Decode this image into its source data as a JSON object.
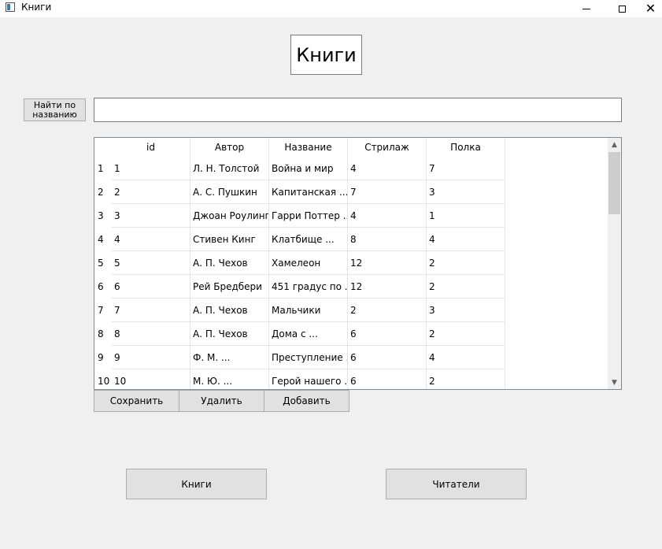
{
  "window": {
    "title": "Книги",
    "close_glyph": "✕"
  },
  "heading": "Книги",
  "search": {
    "button_label_line1": "Найти по",
    "button_label_line2": "названию",
    "value": ""
  },
  "table": {
    "columns": [
      "id",
      "Автор",
      "Название",
      "Стрилаж",
      "Полка"
    ],
    "rows": [
      {
        "num": "1",
        "id": "1",
        "author": "Л. Н. Толстой",
        "title": "Война и мир",
        "rack": "4",
        "shelf": "7"
      },
      {
        "num": "2",
        "id": "2",
        "author": "А. С. Пушкин",
        "title": "Капитанская ...",
        "rack": "7",
        "shelf": "3"
      },
      {
        "num": "3",
        "id": "3",
        "author": "Джоан Роулинг",
        "title": "Гарри Поттер ...",
        "rack": "4",
        "shelf": "1"
      },
      {
        "num": "4",
        "id": "4",
        "author": "Стивен Кинг",
        "title": "Клатбище ...",
        "rack": "8",
        "shelf": "4"
      },
      {
        "num": "5",
        "id": "5",
        "author": "А. П. Чехов",
        "title": "Хамелеон",
        "rack": "12",
        "shelf": "2"
      },
      {
        "num": "6",
        "id": "6",
        "author": "Рей Бредбери",
        "title": "451 градус по ...",
        "rack": "12",
        "shelf": "2"
      },
      {
        "num": "7",
        "id": "7",
        "author": "А. П. Чехов",
        "title": "Мальчики",
        "rack": "2",
        "shelf": "3"
      },
      {
        "num": "8",
        "id": "8",
        "author": "А. П. Чехов",
        "title": "Дома с ...",
        "rack": "6",
        "shelf": "2"
      },
      {
        "num": "9",
        "id": "9",
        "author": "Ф. М. ...",
        "title": "Преступление ...",
        "rack": "6",
        "shelf": "4"
      },
      {
        "num": "10",
        "id": "10",
        "author": "М. Ю. ...",
        "title": "Герой нашего ...",
        "rack": "6",
        "shelf": "2"
      }
    ]
  },
  "actions": {
    "save": "Сохранить",
    "delete": "Удалить",
    "add": "Добавить"
  },
  "nav": {
    "books": "Книги",
    "readers": "Читатели"
  }
}
